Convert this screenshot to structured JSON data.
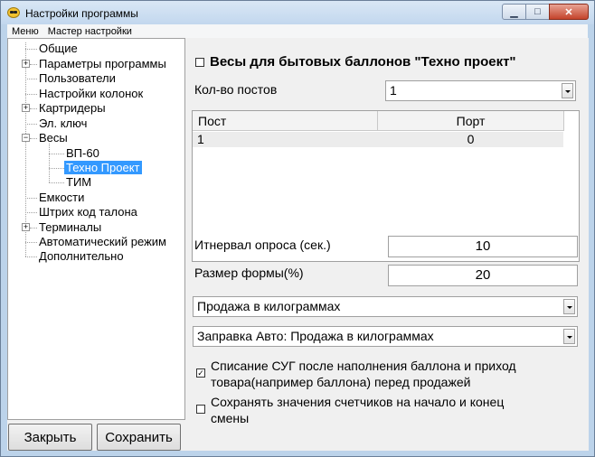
{
  "window": {
    "title": "Настройки программы",
    "controls": {
      "minimize": "▁",
      "maximize": "□",
      "close": "✕"
    }
  },
  "menu": {
    "items": [
      "Меню",
      "Мастер настройки"
    ]
  },
  "tree": {
    "items": [
      {
        "label": "Общие"
      },
      {
        "label": "Параметры программы",
        "expander": "+"
      },
      {
        "label": "Пользователи"
      },
      {
        "label": "Настройки колонок"
      },
      {
        "label": "Картридеры",
        "expander": "+"
      },
      {
        "label": "Эл. ключ"
      },
      {
        "label": "Весы",
        "expander": "−"
      },
      {
        "label": "ВП-60"
      },
      {
        "label": "Техно Проект",
        "selected": true
      },
      {
        "label": "ТИМ"
      },
      {
        "label": "Емкости"
      },
      {
        "label": "Штрих код талона"
      },
      {
        "label": "Терминалы",
        "expander": "+"
      },
      {
        "label": "Автоматический режим"
      },
      {
        "label": "Дополнительно"
      }
    ]
  },
  "buttons": {
    "close": "Закрыть",
    "save": "Сохранить"
  },
  "panel": {
    "enable_label": "Весы для  бытовых баллонов \"Техно проект\"",
    "enable_checked": false,
    "posts_label": "Кол-во постов",
    "posts_value": "1",
    "grid": {
      "columns": [
        "Пост",
        "Порт"
      ],
      "rows": [
        [
          "1",
          "0"
        ]
      ]
    },
    "interval_label": "Итнервал опроса (сек.)",
    "interval_value": "10",
    "form_size_label": "Размер формы(%)",
    "form_size_value": "20",
    "sale_mode_value": "Продажа в килограммах",
    "refuel_mode_value": "Заправка Авто: Продажа в килограммах",
    "writeoff": {
      "checked": true,
      "line1": "Списание СУГ после наполнения баллона и приход",
      "line2": "товара(например баллона) перед продажей"
    },
    "save_counters": {
      "checked": false,
      "line1": "Сохранять значения счетчиков на начало и конец",
      "line2": "смены"
    }
  }
}
